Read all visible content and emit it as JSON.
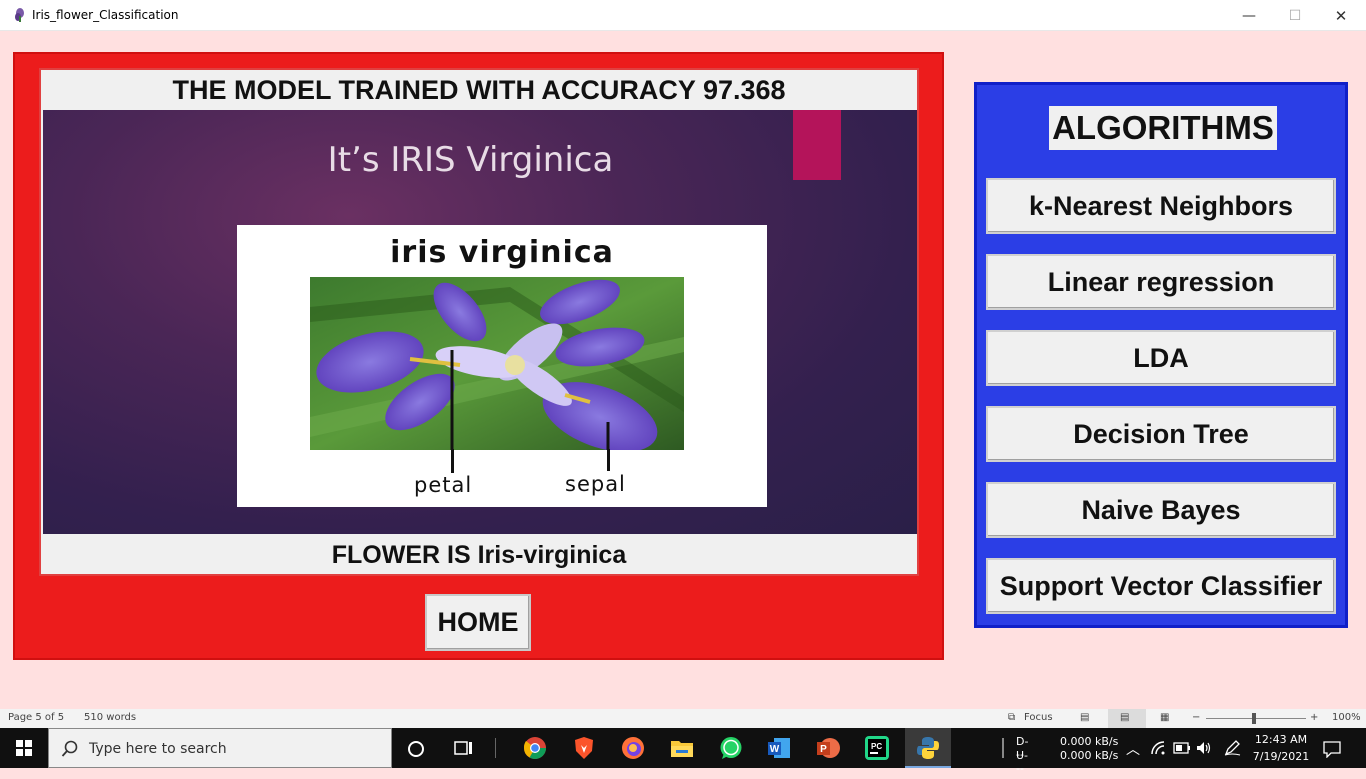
{
  "window": {
    "title": "Iris_flower_Classification",
    "minimize": "—",
    "maximize": "☐",
    "close": "✕"
  },
  "result": {
    "accuracy_text": "THE MODEL TRAINED WITH ACCURACY 97.368",
    "slide_heading": "It’s IRIS Virginica",
    "card_title": "iris virginica",
    "label_petal": "petal",
    "label_sepal": "sepal",
    "flower_text": "FLOWER IS Iris-virginica",
    "home_label": "HOME"
  },
  "algorithms": {
    "title": "ALGORITHMS",
    "items": [
      {
        "label": "k-Nearest Neighbors"
      },
      {
        "label": "Linear regression"
      },
      {
        "label": "LDA"
      },
      {
        "label": "Decision Tree"
      },
      {
        "label": "Naive Bayes"
      },
      {
        "label": "Support Vector Classifier"
      }
    ]
  },
  "word_status": {
    "page": "Page 5 of 5",
    "words": "510 words",
    "focus": "Focus",
    "zoom": "100%"
  },
  "taskbar": {
    "search_placeholder": "Type here to search",
    "apps": [
      "task-view",
      "chrome",
      "brave",
      "firefox",
      "file-explorer",
      "whatsapp",
      "word",
      "powerpoint",
      "pycharm",
      "python"
    ],
    "net_down": "D---",
    "net_up": "U---",
    "down_rate": "0.000 kB/s",
    "up_rate": "0.000 kB/s",
    "time": "12:43 AM",
    "date": "7/19/2021"
  },
  "colors": {
    "background": "#ffe0e0",
    "red_panel": "#ec1c1c",
    "blue_panel": "#2b3ee6",
    "slide_accent": "#b4145a"
  }
}
